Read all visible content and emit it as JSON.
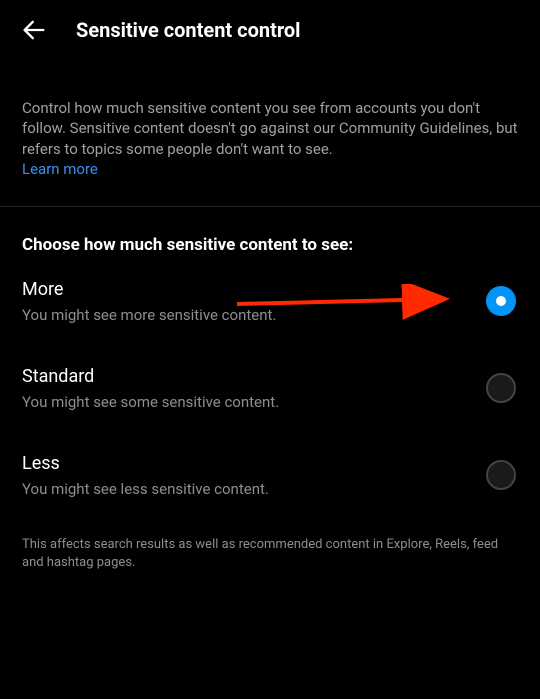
{
  "header": {
    "title": "Sensitive content control"
  },
  "description": {
    "text": "Control how much sensitive content you see from accounts you don't follow. Sensitive content doesn't go against our Community Guidelines, but refers to topics some people don't want to see.",
    "learn_more": "Learn more"
  },
  "section_title": "Choose how much sensitive content to see:",
  "options": [
    {
      "label": "More",
      "sub": "You might see more sensitive content.",
      "selected": true
    },
    {
      "label": "Standard",
      "sub": "You might see some sensitive content.",
      "selected": false
    },
    {
      "label": "Less",
      "sub": "You might see less sensitive content.",
      "selected": false
    }
  ],
  "footer_note": "This affects search results as well as recommended content in Explore, Reels, feed and hashtag pages."
}
